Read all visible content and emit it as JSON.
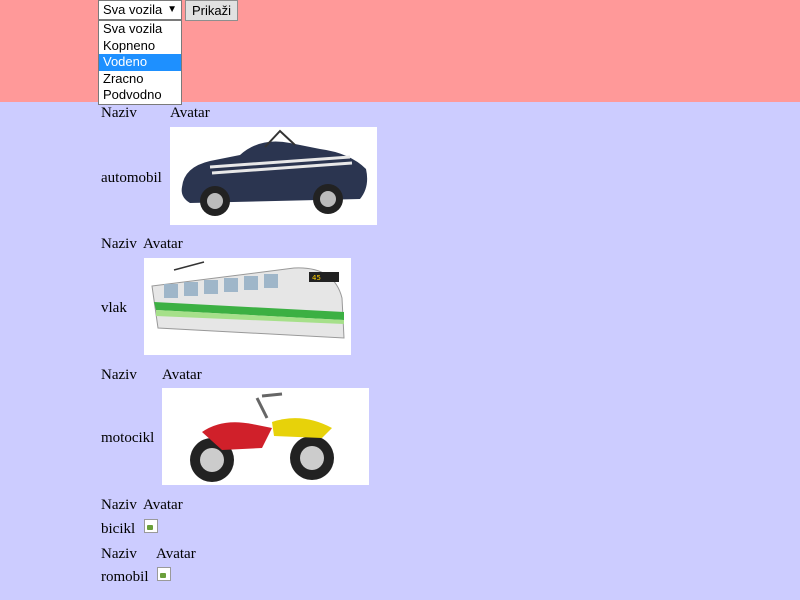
{
  "toolbar": {
    "select_value": "Sva vozila",
    "button_label": "Prikaži",
    "options": [
      "Sva vozila",
      "Kopneno",
      "Vodeno",
      "Zracno",
      "Podvodno"
    ],
    "highlighted_option": "Vodeno"
  },
  "table_header": {
    "naziv": "Naziv",
    "avatar": "Avatar"
  },
  "vehicles": [
    {
      "name": "automobil",
      "avatar": "car-image"
    },
    {
      "name": "vlak",
      "avatar": "tram-image"
    },
    {
      "name": "motocikl",
      "avatar": "motorcycle-image"
    },
    {
      "name": "bicikl",
      "avatar": "broken-image-icon"
    },
    {
      "name": "romobil",
      "avatar": "broken-image-icon"
    }
  ],
  "colors": {
    "header_bg": "#ff9999",
    "page_bg": "#ccccff",
    "option_highlight": "#1e90ff"
  }
}
